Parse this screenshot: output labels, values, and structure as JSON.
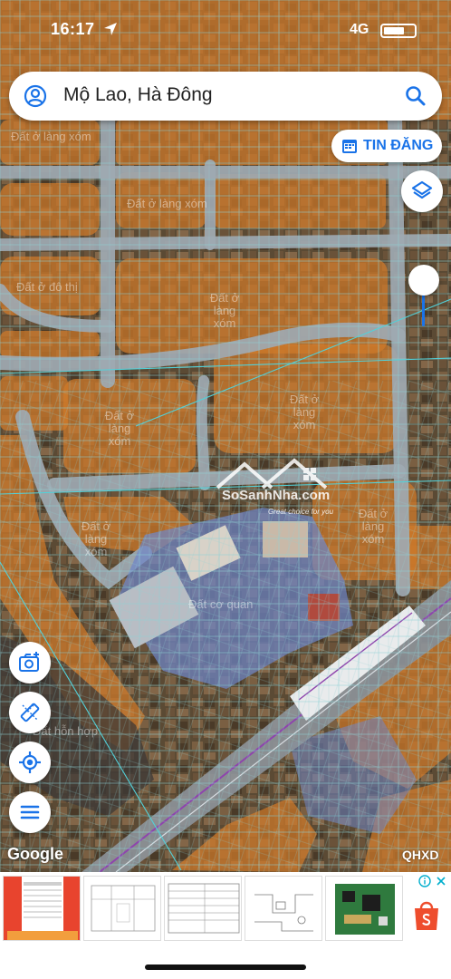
{
  "status_bar": {
    "time": "16:17",
    "network": "4G"
  },
  "search": {
    "location_text": "Mộ Lao, Hà Đông",
    "profile_icon": "user-circle-icon",
    "search_icon": "search-icon"
  },
  "post_button": {
    "label": "TIN ĐĂNG",
    "icon": "calendar-icon"
  },
  "map_controls": {
    "layers_icon": "layers-icon",
    "layer_opacity": 1.0,
    "camera_icon": "add-photo-icon",
    "measure_icon": "ruler-icon",
    "locate_icon": "my-location-icon",
    "menu_icon": "menu-icon"
  },
  "map_labels": [
    "Đất ở làng xóm",
    "Đất ở đô thị",
    "Đất ở làng xóm",
    "Đất ở làng xóm",
    "Đất ở làng xóm",
    "Đất ở làng xóm",
    "Đất ở làng xóm",
    "Đất cơ quan",
    "Đất hỗn hợp"
  ],
  "watermark": {
    "text": "SoSanhNha.com",
    "slogan": "Great choice for you"
  },
  "attribution": {
    "provider": "Google",
    "layer": "QHXD"
  },
  "ad": {
    "info_icon": "info-icon",
    "close_icon": "close-icon",
    "shop_icon": "shopee-bag-icon"
  },
  "colors": {
    "land_overlay": "#d07a2a",
    "road": "#9ea9b2",
    "agency_land": "#6f86c8",
    "accent": "#1a73e8",
    "rail": "#8e44ad"
  }
}
